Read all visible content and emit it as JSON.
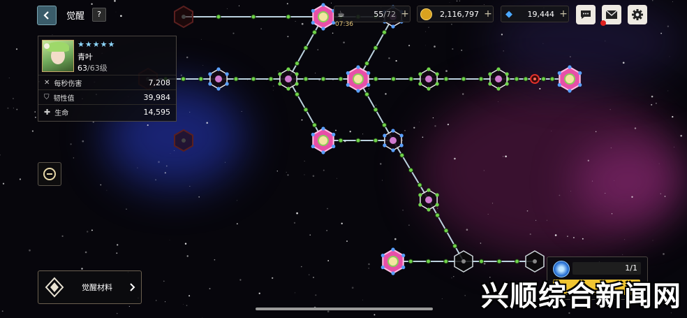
{
  "header": {
    "title": "觉醒",
    "help_label": "?"
  },
  "currency": {
    "stamina": {
      "value": "55",
      "max": "/72",
      "timer": "07:36",
      "icon": "coffee-cup-icon"
    },
    "gold": {
      "value": "2,116,797",
      "icon": "gold-coin-icon"
    },
    "gems": {
      "value": "19,444",
      "icon": "blue-diamond-icon"
    },
    "plus": "+"
  },
  "hero": {
    "stars": "★★★★★",
    "name": "青叶",
    "level_current": "63",
    "level_max": "/63",
    "level_unit": "级",
    "stats": [
      {
        "icon": "crossed-swords-icon",
        "label": "每秒伤害",
        "value": "7,208"
      },
      {
        "icon": "shield-icon",
        "label": "韧性值",
        "value": "39,984"
      },
      {
        "icon": "health-cross-icon",
        "label": "生命",
        "value": "14,595"
      }
    ]
  },
  "materials_button": {
    "label": "觉醒材料"
  },
  "resource_panel": {
    "count": "1/1"
  },
  "watermark": "兴顺综合新闻网",
  "colors": {
    "line": "#cfe8f5",
    "green_node": "#6fd34a",
    "pink": "#e84fa8",
    "blue": "#5aa0ff",
    "gold": "#f2c23a"
  }
}
